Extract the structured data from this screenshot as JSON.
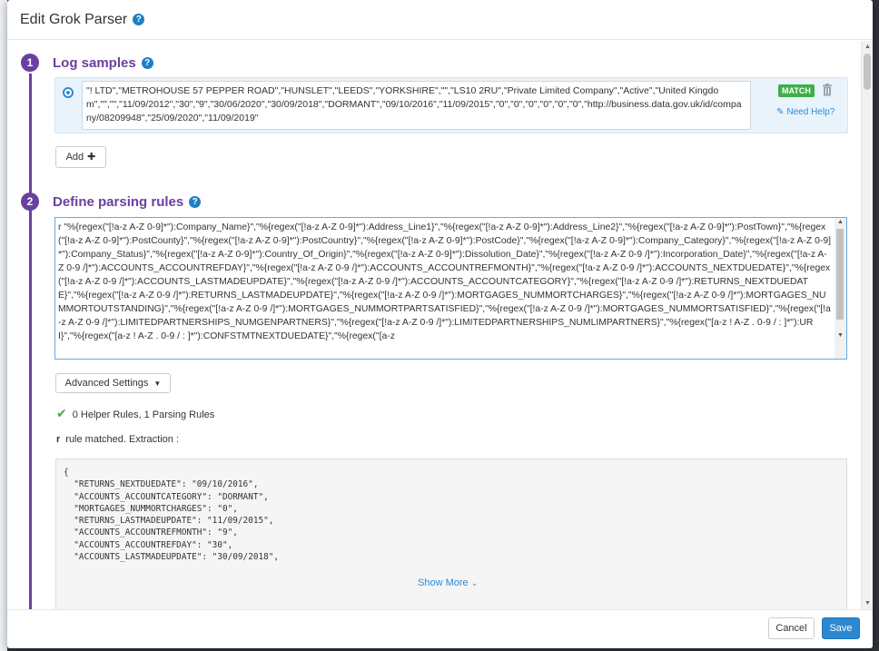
{
  "modal": {
    "title": "Edit Grok Parser",
    "help_icon": "question-circle-icon"
  },
  "steps": [
    {
      "number": "1",
      "title": "Log samples"
    },
    {
      "number": "2",
      "title": "Define parsing rules"
    }
  ],
  "log_sample": {
    "text": "\"! LTD\",\"METROHOUSE 57 PEPPER ROAD\",\"HUNSLET\",\"LEEDS\",\"YORKSHIRE\",\"\",\"LS10 2RU\",\"Private Limited Company\",\"Active\",\"United Kingdom\",\"\",\"\",\"11/09/2012\",\"30\",\"9\",\"30/06/2020\",\"30/09/2018\",\"DORMANT\",\"09/10/2016\",\"11/09/2015\",\"0\",\"0\",\"0\",\"0\",\"0\",\"0\",\"http://business.data.gov.uk/id/company/08209948\",\"25/09/2020\",\"11/09/2019\"",
    "match_badge": "MATCH",
    "need_help": "Need Help?"
  },
  "buttons": {
    "add": "Add",
    "advanced_settings": "Advanced Settings",
    "cancel": "Cancel",
    "save": "Save",
    "show_more": "Show More"
  },
  "parsing_rules": {
    "text": "r \"%{regex(\"[!a-z A-Z 0-9]*\"):Company_Name}\",\"%{regex(\"[!a-z A-Z 0-9]*\"):Address_Line1}\",\"%{regex(\"[!a-z A-Z 0-9]*\"):Address_Line2}\",\"%{regex(\"[!a-z A-Z 0-9]*\"):PostTown}\",\"%{regex(\"[!a-z A-Z 0-9]*\"):PostCounty}\",\"%{regex(\"[!a-z A-Z 0-9]*\"):PostCountry}\",\"%{regex(\"[!a-z A-Z 0-9]*\"):PostCode}\",\"%{regex(\"[!a-z A-Z 0-9]*\"):Company_Category}\",\"%{regex(\"[!a-z A-Z 0-9]*\"):Company_Status}\",\"%{regex(\"[!a-z A-Z 0-9]*\"):Country_Of_Origin}\",\"%{regex(\"[!a-z A-Z 0-9]*\"):Dissolution_Date}\",\"%{regex(\"[!a-z A-Z 0-9 /]*\"):Incorporation_Date}\",\"%{regex(\"[!a-z A-Z 0-9 /]*\"):ACCOUNTS_ACCOUNTREFDAY}\",\"%{regex(\"[!a-z A-Z 0-9 /]*\"):ACCOUNTS_ACCOUNTREFMONTH}\",\"%{regex(\"[!a-z A-Z 0-9 /]*\"):ACCOUNTS_NEXTDUEDATE}\",\"%{regex(\"[!a-z A-Z 0-9 /]*\"):ACCOUNTS_LASTMADEUPDATE}\",\"%{regex(\"[!a-z A-Z 0-9 /]*\"):ACCOUNTS_ACCOUNTCATEGORY}\",\"%{regex(\"[!a-z A-Z 0-9 /]*\"):RETURNS_NEXTDUEDATE}\",\"%{regex(\"[!a-z A-Z 0-9 /]*\"):RETURNS_LASTMADEUPDATE}\",\"%{regex(\"[!a-z A-Z 0-9 /]*\"):MORTGAGES_NUMMORTCHARGES}\",\"%{regex(\"[!a-z A-Z 0-9 /]*\"):MORTGAGES_NUMMORTOUTSTANDING}\",\"%{regex(\"[!a-z A-Z 0-9 /]*\"):MORTGAGES_NUMMORTPARTSATISFIED}\",\"%{regex(\"[!a-z A-Z 0-9 /]*\"):MORTGAGES_NUMMORTSATISFIED}\",\"%{regex(\"[!a-z A-Z 0-9 /]*\"):LIMITEDPARTNERSHIPS_NUMGENPARTNERS}\",\"%{regex(\"[!a-z A-Z 0-9 /]*\"):LIMITEDPARTNERSHIPS_NUMLIMPARTNERS}\",\"%{regex(\"[a-z ! A-Z . 0-9 / : ]*\"):URI}\",\"%{regex(\"[a-z ! A-Z . 0-9 / : ]*\"):CONFSTMTNEXTDUEDATE}\",\"%{regex(\"[a-z"
  },
  "status": {
    "helper_summary": "0 Helper Rules, 1 Parsing Rules",
    "rule_name": "r",
    "matched_text": "rule matched. Extraction :"
  },
  "extraction": {
    "text": "{\n  \"RETURNS_NEXTDUEDATE\": \"09/10/2016\",\n  \"ACCOUNTS_ACCOUNTCATEGORY\": \"DORMANT\",\n  \"MORTGAGES_NUMMORTCHARGES\": \"0\",\n  \"RETURNS_LASTMADEUPDATE\": \"11/09/2015\",\n  \"ACCOUNTS_ACCOUNTREFMONTH\": \"9\",\n  \"ACCOUNTS_ACCOUNTREFDAY\": \"30\",\n  \"ACCOUNTS_LASTMADEUPDATE\": \"30/09/2018\","
  },
  "colors": {
    "accent_purple": "#6b3fa0",
    "primary_blue": "#2c88d1",
    "match_green": "#3fae48"
  }
}
